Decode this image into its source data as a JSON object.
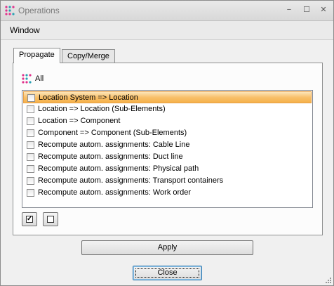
{
  "titlebar": {
    "title": "Operations",
    "minimize_glyph": "−",
    "maximize_glyph": "☐",
    "close_glyph": "✕"
  },
  "menu": {
    "window_label": "Window"
  },
  "tabs": [
    {
      "label": "Propagate",
      "active": true
    },
    {
      "label": "Copy/Merge",
      "active": false
    }
  ],
  "all_label": "All",
  "items": [
    {
      "label": "Location System => Location",
      "checked": false,
      "selected": true
    },
    {
      "label": "Location => Location (Sub-Elements)",
      "checked": false,
      "selected": false
    },
    {
      "label": "Location => Component",
      "checked": false,
      "selected": false
    },
    {
      "label": "Component => Component (Sub-Elements)",
      "checked": false,
      "selected": false
    },
    {
      "label": "Recompute autom. assignments: Cable Line",
      "checked": false,
      "selected": false
    },
    {
      "label": "Recompute autom. assignments: Duct line",
      "checked": false,
      "selected": false
    },
    {
      "label": "Recompute autom. assignments: Physical path",
      "checked": false,
      "selected": false
    },
    {
      "label": "Recompute autom. assignments: Transport containers",
      "checked": false,
      "selected": false
    },
    {
      "label": "Recompute autom. assignments: Work order",
      "checked": false,
      "selected": false
    }
  ],
  "check_all_glyph": "✓",
  "buttons": {
    "apply": "Apply",
    "close": "Close"
  },
  "colors": {
    "selection": "#f8c06b",
    "icon_pink": "#e0328c",
    "icon_teal": "#2aa0b4"
  }
}
